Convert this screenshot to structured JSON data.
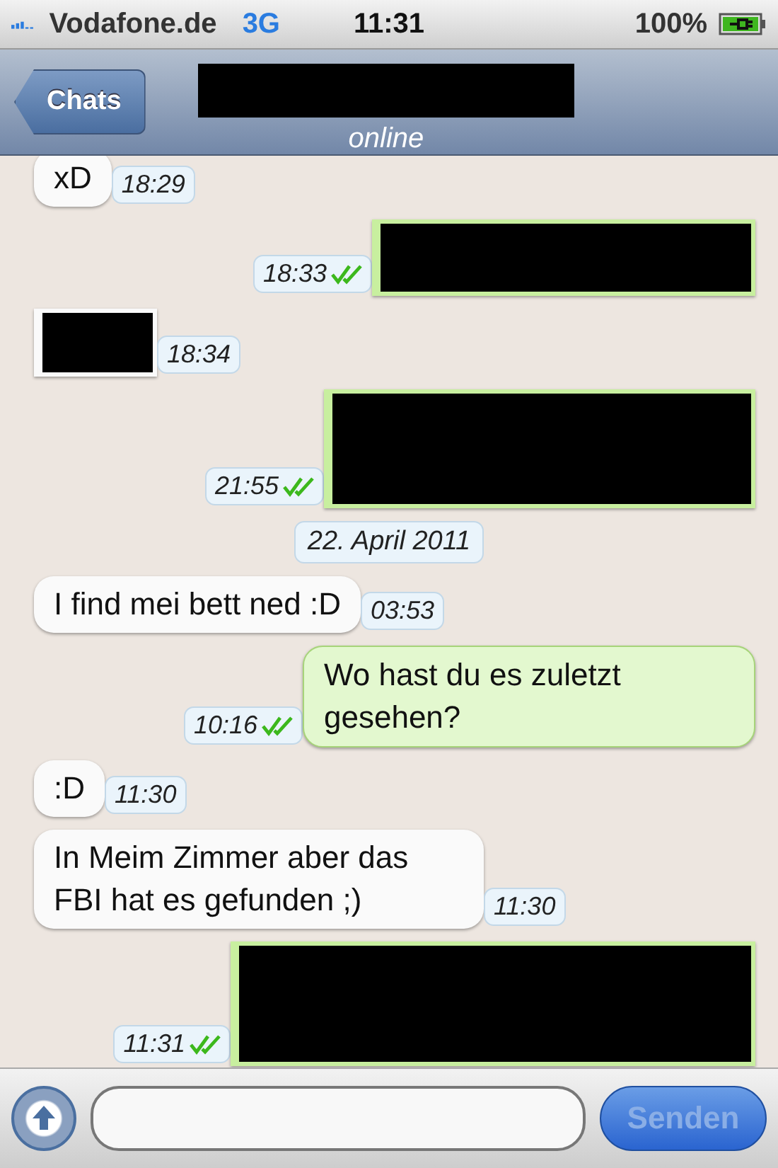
{
  "status_bar": {
    "carrier": "Vodafone.de",
    "network": "3G",
    "time": "11:31",
    "battery": "100%",
    "charging": true
  },
  "nav": {
    "back": "Chats",
    "title_redacted": true,
    "subtitle": "online"
  },
  "messages": [
    {
      "kind": "text",
      "outgoing": false,
      "text": "xD",
      "time": "18:29"
    },
    {
      "kind": "redacted",
      "outgoing": true,
      "time": "18:33",
      "delivered": true
    },
    {
      "kind": "redacted",
      "outgoing": false,
      "time": "18:34"
    },
    {
      "kind": "redacted",
      "outgoing": true,
      "time": "21:55",
      "delivered": true
    },
    {
      "kind": "date",
      "text": "22. April 2011"
    },
    {
      "kind": "text",
      "outgoing": false,
      "text": "I find mei bett ned :D",
      "time": "03:53"
    },
    {
      "kind": "text",
      "outgoing": true,
      "text": "Wo hast du es zuletzt gesehen?",
      "time": "10:16",
      "delivered": true
    },
    {
      "kind": "text",
      "outgoing": false,
      "text": ":D",
      "time": "11:30"
    },
    {
      "kind": "text",
      "outgoing": false,
      "text": "In Meim Zimmer aber das FBI hat es gefunden ;)",
      "time": "11:30"
    },
    {
      "kind": "redacted",
      "outgoing": true,
      "time": "11:31",
      "delivered": true
    }
  ],
  "composer": {
    "send": "Senden",
    "send_disabled": true
  }
}
